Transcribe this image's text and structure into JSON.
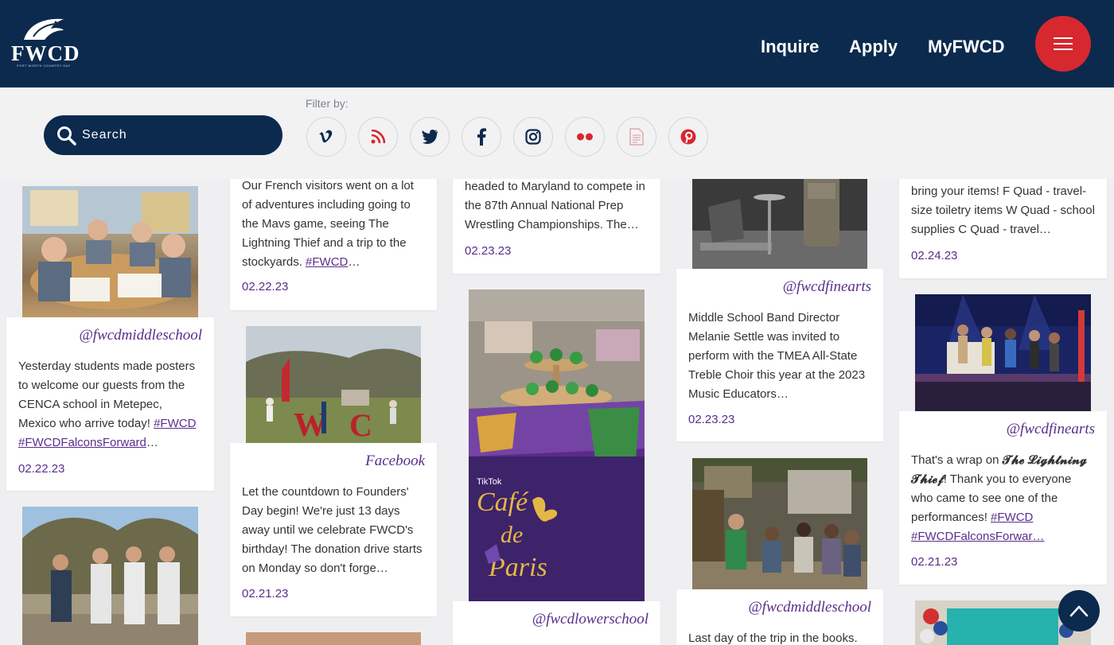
{
  "header": {
    "logo_text": "FWCD",
    "logo_sub": "FORT WORTH COUNTRY DAY",
    "nav": [
      "Inquire",
      "Apply",
      "MyFWCD"
    ]
  },
  "filter": {
    "search_placeholder": "Search",
    "label": "Filter by:",
    "icons": [
      "vimeo-icon",
      "rss-icon",
      "twitter-icon",
      "facebook-icon",
      "instagram-icon",
      "flickr-icon",
      "news-icon",
      "pinterest-icon"
    ]
  },
  "cards": {
    "c1": {
      "handle": "@fwcdmiddleschool",
      "text": "Yesterday students made posters to welcome our guests from the CENCA school in Metepec, Mexico who arrive today! ",
      "tag1": "#FWCD",
      "tag2": "#FWCDFalconsForward",
      "date": "02.22.23"
    },
    "c2": {
      "text": "Our French visitors went on a lot of adventures including going to the Mavs game, seeing The Lightning Thief and a trip to the stockyards. ",
      "tag1": "#FWCD",
      "date": "02.22.23"
    },
    "c3": {
      "handle": "Facebook",
      "text": "Let the countdown to Founders' Day begin! We're just 13 days away until we celebrate FWCD's birthday! The donation drive starts on Monday so don't forge…",
      "date": "02.21.23"
    },
    "c4": {
      "text": "headed to Maryland to compete in the 87th Annual National Prep Wrestling Championships. The…",
      "date": "02.23.23"
    },
    "c5": {
      "handle": "@fwcdlowerschool",
      "photo_text1": "Café",
      "photo_text2": "de",
      "photo_text3": "Paris",
      "photo_tiktok": "TikTok"
    },
    "c6": {
      "handle": "@fwcdfinearts",
      "text": "Middle School Band Director Melanie Settle was invited to perform with the TMEA All-State Treble Choir this year at the 2023 Music Educators…",
      "date": "02.23.23"
    },
    "c7": {
      "handle": "@fwcdmiddleschool",
      "text": "Last day of the trip in the books."
    },
    "c8": {
      "text": "bring your items! F Quad - travel-size toiletry items W Quad - school supplies C Quad - travel…",
      "date": "02.24.23"
    },
    "c9": {
      "handle": "@fwcdfinearts",
      "text_a": "That's a wrap on ",
      "text_b": "𝓣𝓱𝓮 𝓛𝓲𝓰𝓱𝓽𝓷𝓲𝓷𝓰 𝓣𝓱𝓲𝓮𝓯",
      "text_c": "! Thank you to everyone who came to see one of the performances! ",
      "tag1": "#FWCD",
      "tag2": "#FWCDFalconsForwar…",
      "date": "02.21.23"
    }
  },
  "colors": {
    "navy": "#0b2a4d",
    "red": "#d7272f",
    "purple": "#5a2d8c"
  }
}
